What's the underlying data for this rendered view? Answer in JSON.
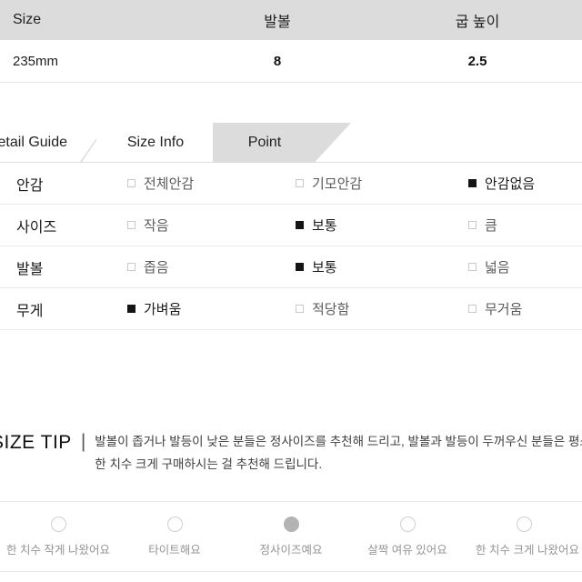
{
  "size_table": {
    "headers": [
      "Size",
      "발볼",
      "굽 높이"
    ],
    "rows": [
      {
        "size": "235mm",
        "width": "8",
        "heel": "2.5"
      }
    ]
  },
  "tabs": [
    {
      "label": "Detail Guide",
      "active": false
    },
    {
      "label": "Size Info",
      "active": false
    },
    {
      "label": "Point",
      "active": true
    }
  ],
  "spec_table": {
    "rows": [
      {
        "label": "안감",
        "options": [
          {
            "text": "전체안감",
            "selected": false
          },
          {
            "text": "기모안감",
            "selected": false
          },
          {
            "text": "안감없음",
            "selected": true
          }
        ]
      },
      {
        "label": "사이즈",
        "options": [
          {
            "text": "작음",
            "selected": false
          },
          {
            "text": "보통",
            "selected": true
          },
          {
            "text": "큼",
            "selected": false
          }
        ]
      },
      {
        "label": "발볼",
        "options": [
          {
            "text": "좁음",
            "selected": false
          },
          {
            "text": "보통",
            "selected": true
          },
          {
            "text": "넓음",
            "selected": false
          }
        ]
      },
      {
        "label": "무게",
        "options": [
          {
            "text": "가벼움",
            "selected": true
          },
          {
            "text": "적당함",
            "selected": false
          },
          {
            "text": "무거움",
            "selected": false
          }
        ]
      }
    ]
  },
  "size_tip": {
    "title": "SIZE TIP",
    "divider": "|",
    "line1": "발볼이 좁거나 발등이 낮은 분들은 정사이즈를 추천해 드리고, 발볼과 발등이 두꺼우신 분들은 평소 사이즈보다",
    "line2": "한 치수 크게 구매하시는 걸 추천해 드립니다."
  },
  "fit_survey": {
    "options": [
      {
        "label": "한 치수 작게 나왔어요",
        "selected": false
      },
      {
        "label": "타이트해요",
        "selected": false
      },
      {
        "label": "정사이즈예요",
        "selected": true
      },
      {
        "label": "살짝 여유 있어요",
        "selected": false
      },
      {
        "label": "한 치수 크게 나왔어요",
        "selected": false
      }
    ]
  },
  "colors": {
    "header_bg": "#dcdcdc",
    "active_tab_bg": "#dcdcdc",
    "checkbox_on": "#141414",
    "checkbox_off_border": "#c9c9c9",
    "radio_selected": "#b3b3b3",
    "radio_border": "#cfcfcf"
  }
}
